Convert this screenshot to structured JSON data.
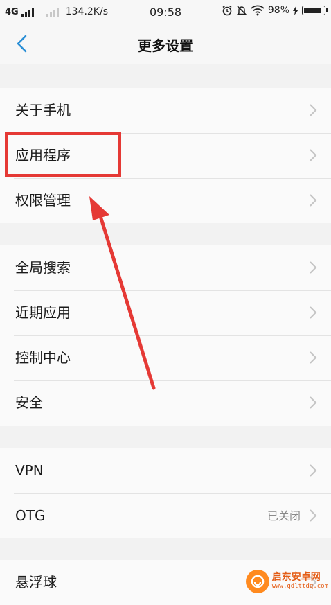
{
  "status_bar": {
    "network": "4G",
    "speed": "134.2K/s",
    "time": "09:58",
    "battery": "98%",
    "battery_level": 0.98
  },
  "header": {
    "title": "更多设置",
    "back_icon": "chevron-left-icon",
    "accent_color": "#2b8fd6"
  },
  "groups": [
    {
      "items": [
        {
          "label": "关于手机"
        },
        {
          "label": "应用程序"
        },
        {
          "label": "权限管理"
        }
      ]
    },
    {
      "items": [
        {
          "label": "全局搜索"
        },
        {
          "label": "近期应用"
        },
        {
          "label": "控制中心"
        },
        {
          "label": "安全"
        }
      ]
    },
    {
      "items": [
        {
          "label": "VPN"
        },
        {
          "label": "OTG",
          "value": "已关闭"
        }
      ]
    },
    {
      "items": [
        {
          "label": "悬浮球"
        }
      ]
    }
  ],
  "annotation": {
    "highlight_color": "#e53935",
    "highlighted_item": "应用程序"
  },
  "watermark": {
    "name": "启东安卓网",
    "url": "www.qdlttdq.com"
  }
}
